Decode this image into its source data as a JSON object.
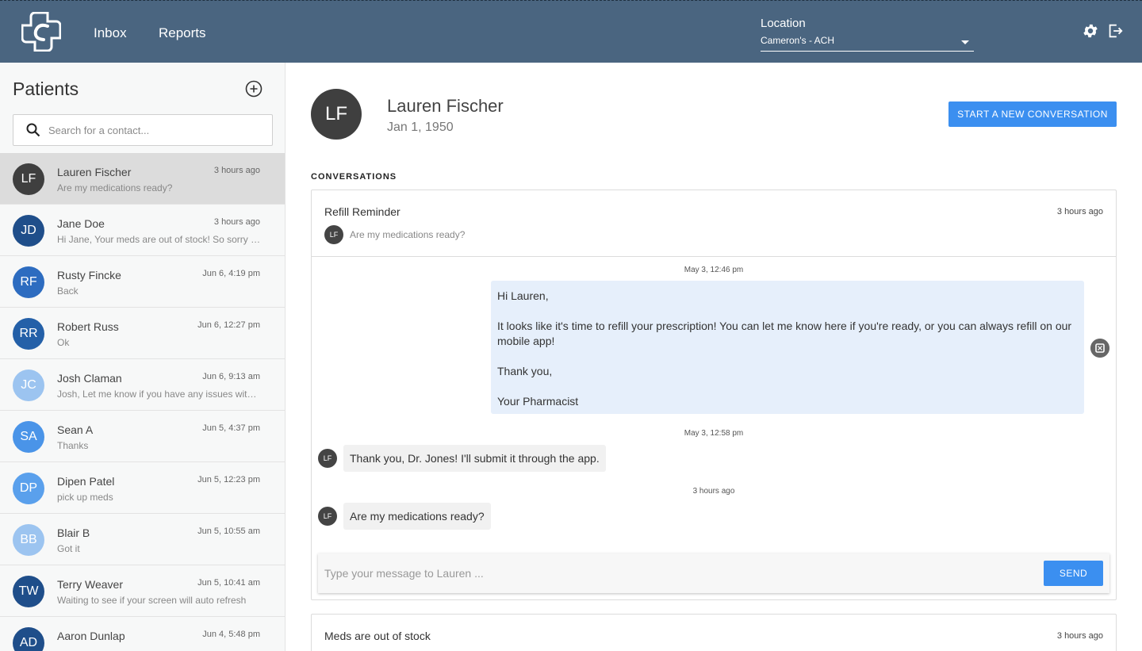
{
  "header": {
    "nav": {
      "inbox": "Inbox",
      "reports": "Reports"
    },
    "location": {
      "label": "Location",
      "value": "Cameron's - ACH"
    },
    "icons": [
      "plus-cross-logo",
      "gear-icon",
      "logout-icon"
    ],
    "colors": {
      "bar": "#4a6580",
      "accent": "#3b8ff0"
    }
  },
  "sidebar": {
    "title": "Patients",
    "search_placeholder": "Search for a contact...",
    "patients": [
      {
        "initials": "LF",
        "name": "Lauren Fischer",
        "time": "3 hours ago",
        "message": "Are my medications ready?",
        "color": "#3f3f3f",
        "active": true
      },
      {
        "initials": "JD",
        "name": "Jane Doe",
        "time": "3 hours ago",
        "message": "Hi Jane, Your meds are out of stock! So sorry about that",
        "color": "#1f4e8a"
      },
      {
        "initials": "RF",
        "name": "Rusty Fincke",
        "time": "Jun 6, 4:19 pm",
        "message": "Back",
        "color": "#2d6cc0"
      },
      {
        "initials": "RR",
        "name": "Robert Russ",
        "time": "Jun 6, 12:27 pm",
        "message": "Ok",
        "color": "#2460a8"
      },
      {
        "initials": "JC",
        "name": "Josh Claman",
        "time": "Jun 6, 9:13 am",
        "message": "Josh, Let me know if you have any issues with the app",
        "color": "#9cc4f0"
      },
      {
        "initials": "SA",
        "name": "Sean A",
        "time": "Jun 5, 4:37 pm",
        "message": "Thanks",
        "color": "#4a94e8"
      },
      {
        "initials": "DP",
        "name": "Dipen Patel",
        "time": "Jun 5, 12:23 pm",
        "message": "pick up meds",
        "color": "#5aa0ec"
      },
      {
        "initials": "BB",
        "name": "Blair B",
        "time": "Jun 5, 10:55 am",
        "message": "Got it",
        "color": "#9cc4f0"
      },
      {
        "initials": "TW",
        "name": "Terry Weaver",
        "time": "Jun 5, 10:41 am",
        "message": "Waiting to see if your screen will auto refresh",
        "color": "#1f4e8a"
      },
      {
        "initials": "AD",
        "name": "Aaron Dunlap",
        "time": "Jun 4, 5:48 pm",
        "message": "",
        "color": "#1f4e8a"
      }
    ]
  },
  "main": {
    "patient": {
      "initials": "LF",
      "name": "Lauren Fischer",
      "dob": "Jan 1, 1950"
    },
    "new_conversation_label": "START A NEW CONVERSATION",
    "conversations_heading": "CONVERSATIONS",
    "conversations": [
      {
        "title": "Refill Reminder",
        "time": "3 hours ago",
        "preview_initials": "LF",
        "preview": "Are my medications ready?",
        "stamps": [
          "May 3, 12:46 pm",
          "May 3, 12:58 pm",
          "3 hours ago"
        ],
        "outgoing_lines": [
          "Hi Lauren,",
          "It looks like it's time to refill your prescription! You can let me know here if you're ready, or you can always refill on our mobile app!",
          "Thank you,",
          "Your Pharmacist"
        ],
        "incoming": [
          {
            "initials": "LF",
            "text": "Thank you, Dr. Jones! I'll submit it through the app."
          },
          {
            "initials": "LF",
            "text": "Are my medications ready?"
          }
        ],
        "composer_placeholder": "Type your message to Lauren ...",
        "send_label": "SEND"
      },
      {
        "title": "Meds are out of stock",
        "time": "3 hours ago"
      }
    ]
  }
}
